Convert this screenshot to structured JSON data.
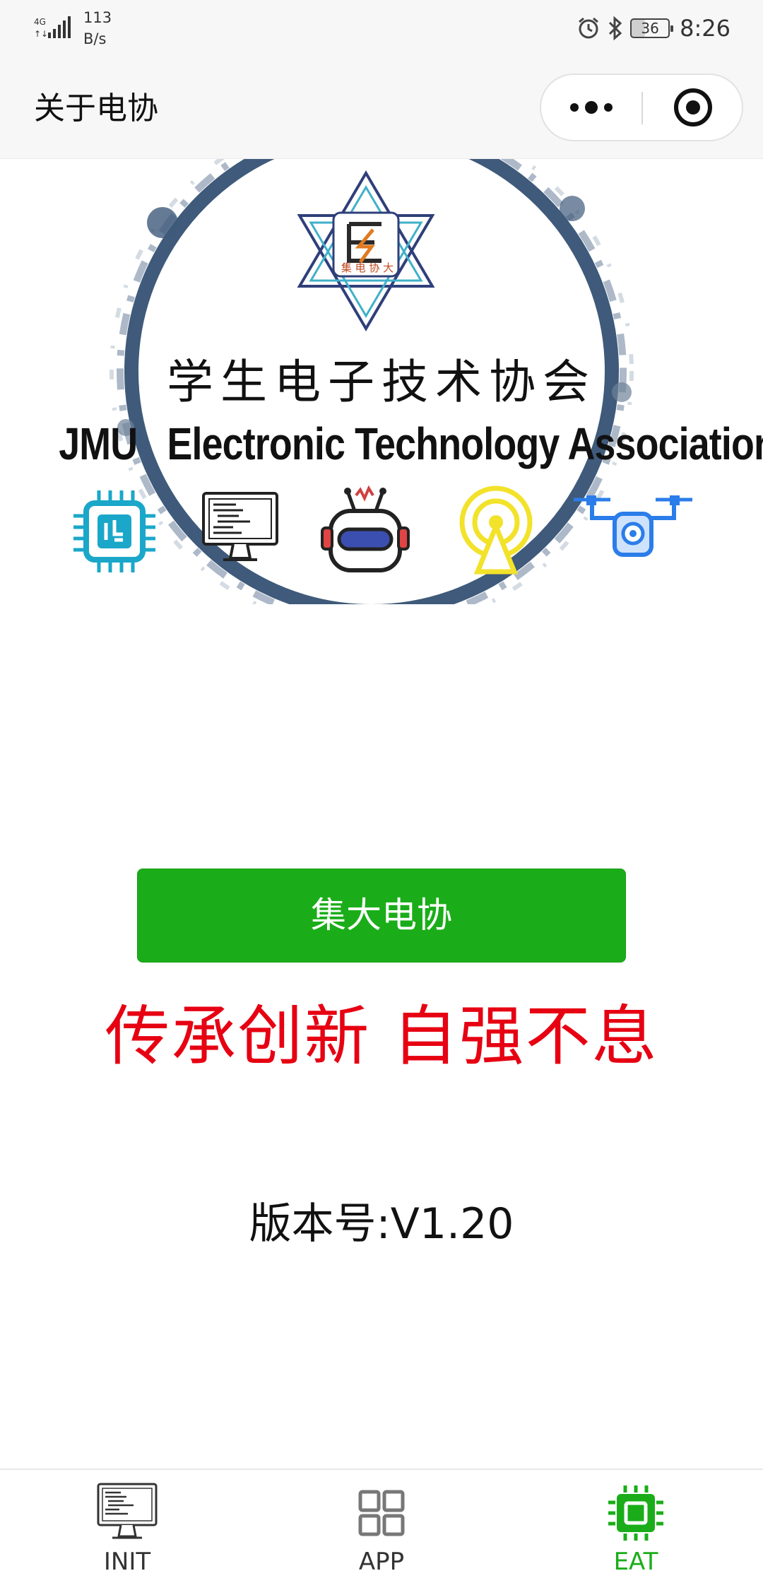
{
  "status_bar": {
    "network_type": "4G",
    "speed_value": "113",
    "speed_unit": "B/s",
    "battery": "36",
    "time": "8:26",
    "icons": [
      "signal-icon",
      "alarm-icon",
      "bluetooth-icon",
      "battery-icon"
    ]
  },
  "nav": {
    "title": "关于电协",
    "more_icon": "more-dots-icon",
    "close_icon": "target-close-icon"
  },
  "banner": {
    "cn_name": "学生电子技术协会",
    "en_name": "JMU   Electronic Technology Association",
    "logo_text": "集 电 协 大",
    "icons": [
      "chip-icon",
      "computer-icon",
      "robot-icon",
      "antenna-icon",
      "drone-icon"
    ],
    "colors": {
      "ring": "#3f5a7a",
      "chip": "#1aa7c9",
      "antenna": "#f2e22a",
      "drone": "#2b7de9"
    }
  },
  "main": {
    "button_label": "集大电协",
    "slogan": "传承创新 自强不息",
    "version": "版本号:V1.20"
  },
  "tabs": [
    {
      "label": "INIT",
      "icon": "computer-icon",
      "active": false
    },
    {
      "label": "APP",
      "icon": "grid-icon",
      "active": false
    },
    {
      "label": "EAT",
      "icon": "chip-icon",
      "active": true
    }
  ],
  "colors": {
    "primary_green": "#1aad19",
    "slogan_red": "#e60012",
    "bar_bg": "#f7f7f7"
  }
}
